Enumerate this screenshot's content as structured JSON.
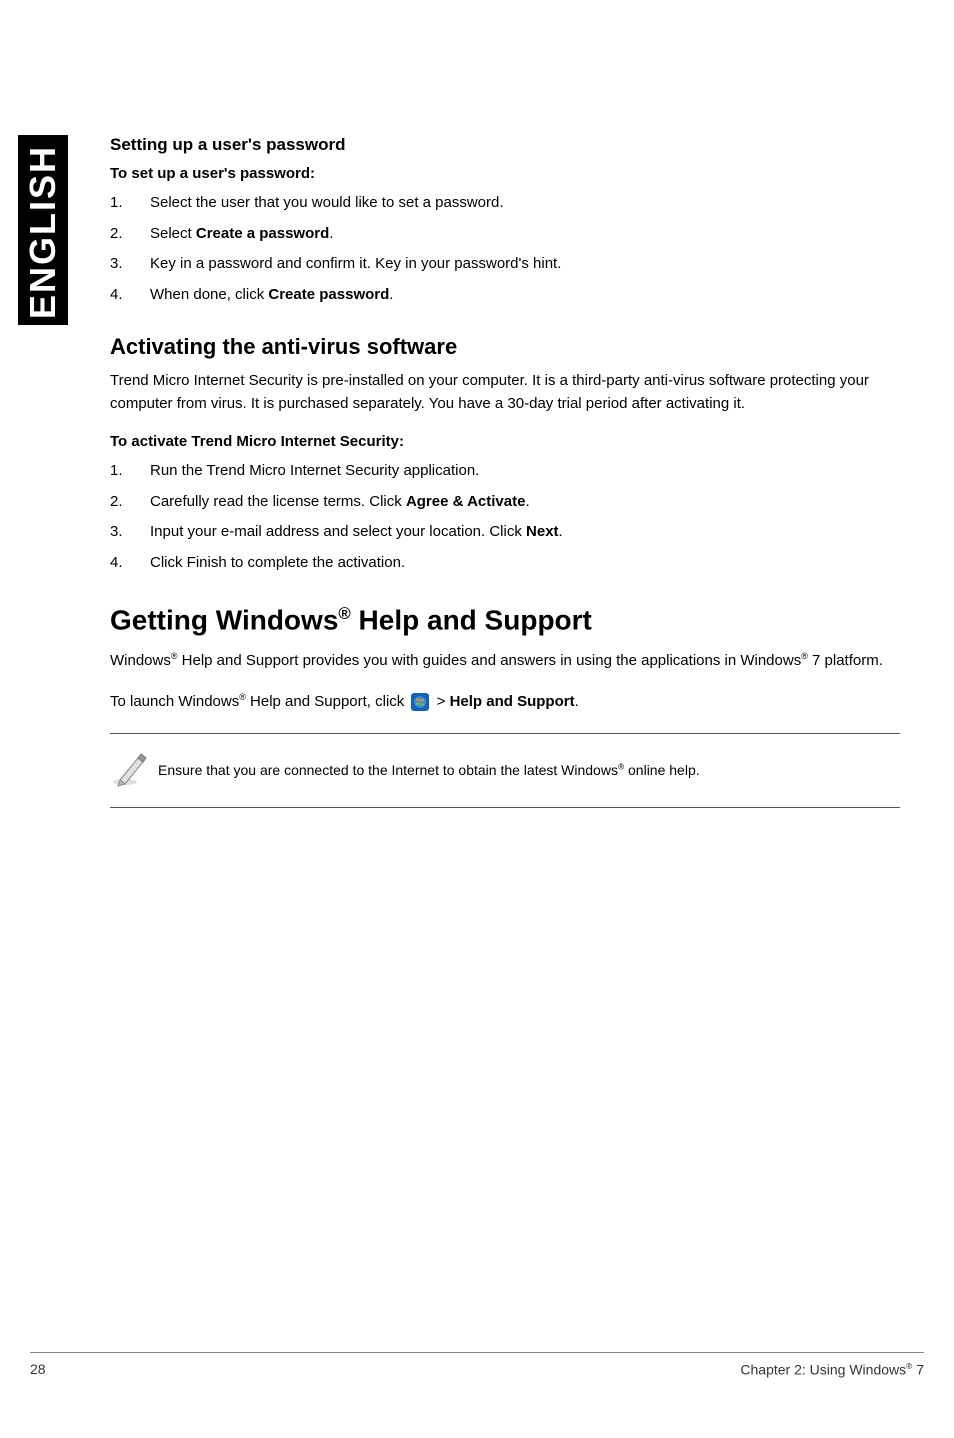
{
  "sidebar": {
    "label": "ENGLISH"
  },
  "section1": {
    "title": "Setting up a user's password",
    "subtitle": "To set up a user's password:",
    "steps": [
      "Select the user that you would like to set a password.",
      "Select <b>Create a password</b>.",
      "Key in a password and confirm it. Key in your password's hint.",
      "When done, click <b>Create password</b>."
    ]
  },
  "section2": {
    "title": "Activating the anti-virus software",
    "intro": "Trend Micro Internet Security is pre-installed on your computer. It is a third-party anti-virus software protecting your computer from virus. It is purchased separately. You have a 30-day trial period after activating it.",
    "subtitle": "To activate Trend Micro Internet Security:",
    "steps": [
      "Run the Trend Micro Internet Security application.",
      "Carefully read the license terms. Click <b>Agree & Activate</b>.",
      "Input your e-mail address and select your location. Click <b>Next</b>.",
      "Click Finish to complete the activation."
    ]
  },
  "section3": {
    "title_pre": "Getting Windows",
    "title_sup": "®",
    "title_post": " Help and Support",
    "para1_pre": "Windows",
    "para1_sup": "®",
    "para1_mid": " Help and Support provides you with guides and answers in using the applications in Windows",
    "para1_sup2": "®",
    "para1_end": " 7 platform.",
    "para2_pre": "To launch Windows",
    "para2_sup": "®",
    "para2_mid": " Help and Support, click ",
    "para2_post": " > <b>Help and Support</b>.",
    "note_pre": "Ensure that you are connected to the Internet to obtain the latest Windows",
    "note_sup": "®",
    "note_post": " online help."
  },
  "icons": {
    "windows_start": "windows-start-icon",
    "pencil_note": "pencil-note-icon"
  },
  "footer": {
    "page": "28",
    "chapter_pre": "Chapter 2: Using Windows",
    "chapter_sup": "®",
    "chapter_post": " 7"
  }
}
